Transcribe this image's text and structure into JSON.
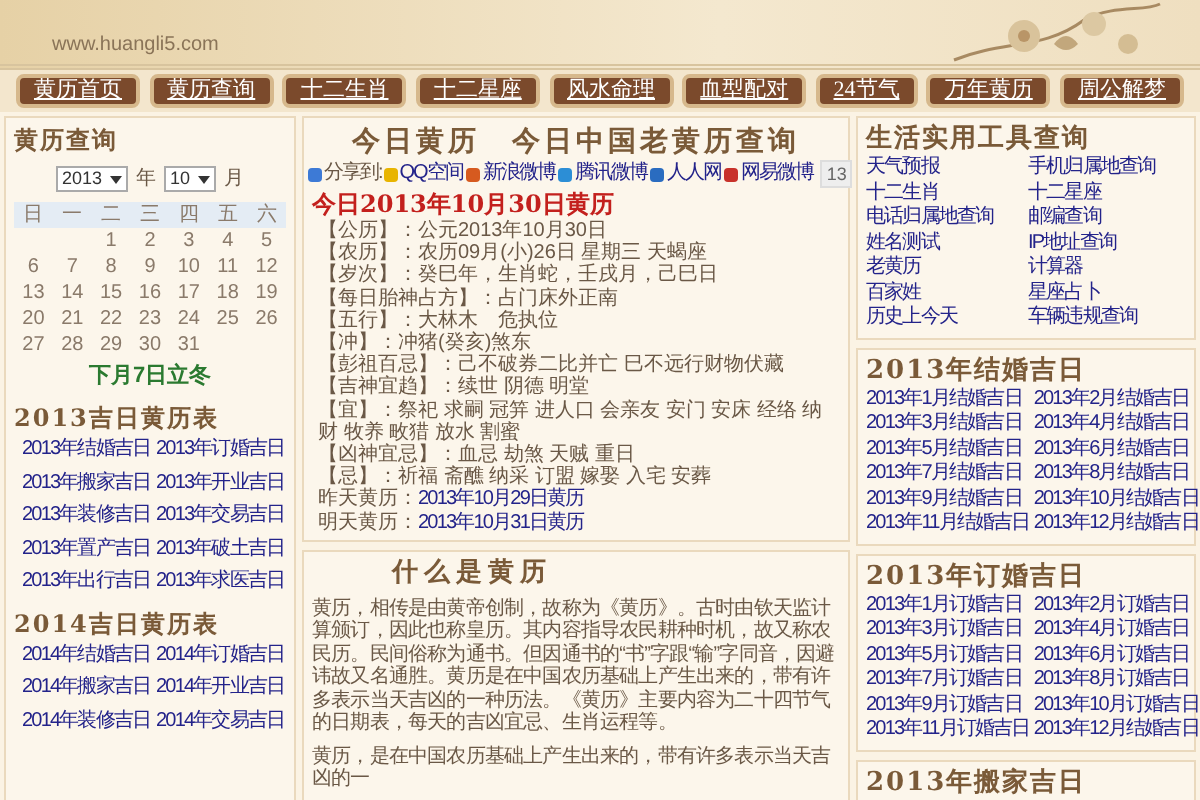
{
  "header": {
    "url": "www.huangli5.com"
  },
  "nav": [
    {
      "label": "黄历首页"
    },
    {
      "label": "黄历查询"
    },
    {
      "label": "十二生肖"
    },
    {
      "label": "十二星座"
    },
    {
      "label": "风水命理"
    },
    {
      "label": "血型配对"
    },
    {
      "label": "24节气"
    },
    {
      "label": "万年黄历"
    },
    {
      "label": "周公解梦"
    }
  ],
  "left": {
    "title": "黄历查询",
    "year": "2013",
    "year_unit": "年",
    "month": "10",
    "month_unit": "月",
    "weekdays": [
      "日",
      "一",
      "二",
      "三",
      "四",
      "五",
      "六"
    ],
    "weeks": [
      {
        "kind": "first",
        "days": [
          "1",
          "2",
          "3",
          "4",
          "5"
        ]
      },
      {
        "kind": "full",
        "days": [
          "6",
          "7",
          "8",
          "9",
          "10",
          "11",
          "12"
        ]
      },
      {
        "kind": "full",
        "days": [
          "13",
          "14",
          "15",
          "16",
          "17",
          "18",
          "19"
        ]
      },
      {
        "kind": "full",
        "days": [
          "20",
          "21",
          "22",
          "23",
          "24",
          "25",
          "26"
        ]
      },
      {
        "kind": "last",
        "days": [
          "27",
          "28",
          "29",
          "30",
          "31"
        ]
      }
    ],
    "solar_term_note": "下月7日立冬",
    "sections": [
      {
        "title": "2013吉日黄历表",
        "links": [
          "2013年结婚吉日",
          "2013年订婚吉日",
          "2013年搬家吉日",
          "2013年开业吉日",
          "2013年装修吉日",
          "2013年交易吉日",
          "2013年置产吉日",
          "2013年破土吉日",
          "2013年出行吉日",
          "2013年求医吉日"
        ]
      },
      {
        "title": "2014吉日黄历表",
        "links": [
          "2014年结婚吉日",
          "2014年订婚吉日",
          "2014年搬家吉日",
          "2014年开业吉日",
          "2014年装修吉日",
          "2014年交易吉日"
        ]
      }
    ]
  },
  "center": {
    "title": "今日黄历　今日中国老黄历查询",
    "share": {
      "label": "分享到:",
      "items": [
        "QQ空间",
        "新浪微博",
        "腾讯微博",
        "人人网",
        "网易微博"
      ],
      "count": "13"
    },
    "today_heading": "今日2013年10月30日黄历",
    "entries": [
      "【公历】：公元2013年10月30日",
      "【农历】：农历09月(小)26日 星期三 天蝎座",
      "【岁次】：癸巳年，生肖蛇，壬戌月，己巳日",
      "【每日胎神占方】：占门床外正南",
      "【五行】：大林木　危执位",
      "【冲】：冲猪(癸亥)煞东",
      "【彭祖百忌】：己不破券二比并亡 巳不远行财物伏藏",
      "【吉神宜趋】：续世 阴德 明堂",
      "【宜】：祭祀 求嗣 冠笄 进人口 会亲友 安门 安床 经络 纳财 牧养 畋猎 放水 割蜜",
      "【凶神宜忌】：血忌 劫煞 天贼 重日",
      "【忌】：祈福 斋醮 纳采 订盟 嫁娶 入宅 安葬"
    ],
    "day_links": [
      {
        "label": "昨天黄历：",
        "link": "2013年10月29日黄历"
      },
      {
        "label": "明天黄历：",
        "link": "2013年10月31日黄历"
      }
    ],
    "about": {
      "title": "什么是黄历",
      "paragraphs": [
        "黄历，相传是由黄帝创制，故称为《黄历》。古时由钦天监计算颁订，因此也称皇历。其内容指导农民耕种时机，故又称农民历。民间俗称为通书。但因通书的“书”字跟“输”字同音，因避讳故又名通胜。黄历是在中国农历基础上产生出来的，带有许多表示当天吉凶的一种历法。《黄历》主要内容为二十四节气的日期表，每天的吉凶宜忌、生肖运程等。",
        "黄历，是在中国农历基础上产生出来的，带有许多表示当天吉凶的一"
      ]
    }
  },
  "right": {
    "tools": {
      "title": "生活实用工具查询",
      "links": [
        "天气预报",
        "手机归属地查询",
        "十二生肖",
        "十二星座",
        "电话归属地查询",
        "邮编查询",
        "姓名测试",
        "IP地址查询",
        "老黄历",
        "计算器",
        "百家姓",
        "星座占卜",
        "历史上今天",
        "车辆违规查询"
      ]
    },
    "panels": [
      {
        "title": "2013年结婚吉日",
        "links": [
          "2013年1月结婚吉日",
          "2013年2月结婚吉日",
          "2013年3月结婚吉日",
          "2013年4月结婚吉日",
          "2013年5月结婚吉日",
          "2013年6月结婚吉日",
          "2013年7月结婚吉日",
          "2013年8月结婚吉日",
          "2013年9月结婚吉日",
          "2013年10月结婚吉日",
          "2013年11月结婚吉日",
          "2013年12月结婚吉日"
        ]
      },
      {
        "title": "2013年订婚吉日",
        "links": [
          "2013年1月订婚吉日",
          "2013年2月订婚吉日",
          "2013年3月订婚吉日",
          "2013年4月订婚吉日",
          "2013年5月订婚吉日",
          "2013年6月订婚吉日",
          "2013年7月订婚吉日",
          "2013年8月订婚吉日",
          "2013年9月订婚吉日",
          "2013年10月订婚吉日",
          "2013年11月订婚吉日",
          "2013年12月结婚吉日"
        ]
      },
      {
        "title": "2013年搬家吉日"
      }
    ]
  }
}
